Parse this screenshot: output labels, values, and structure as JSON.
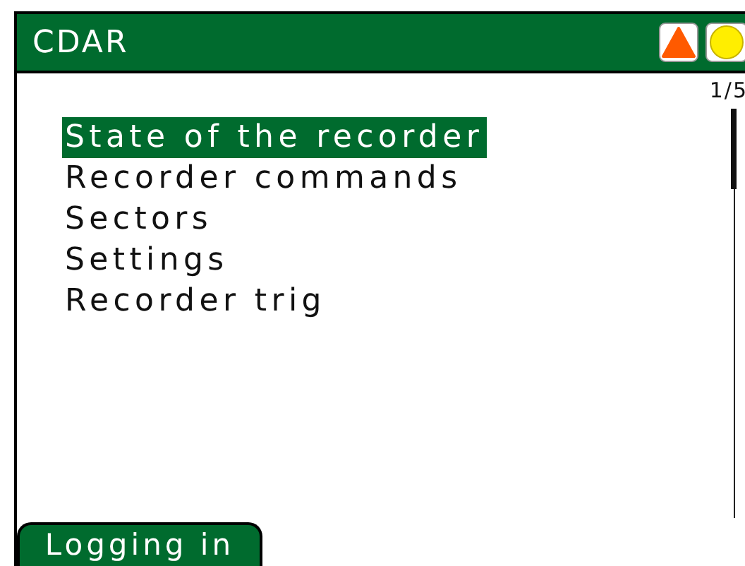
{
  "window": {
    "title": "CDAR"
  },
  "page_indicator": "1/5",
  "menu": {
    "items": [
      {
        "label": "State of the recorder",
        "selected": true
      },
      {
        "label": "Recorder commands",
        "selected": false
      },
      {
        "label": "Sectors",
        "selected": false
      },
      {
        "label": "Settings",
        "selected": false
      },
      {
        "label": "Recorder trig",
        "selected": false
      }
    ]
  },
  "softkeys": [
    "Logging in"
  ]
}
